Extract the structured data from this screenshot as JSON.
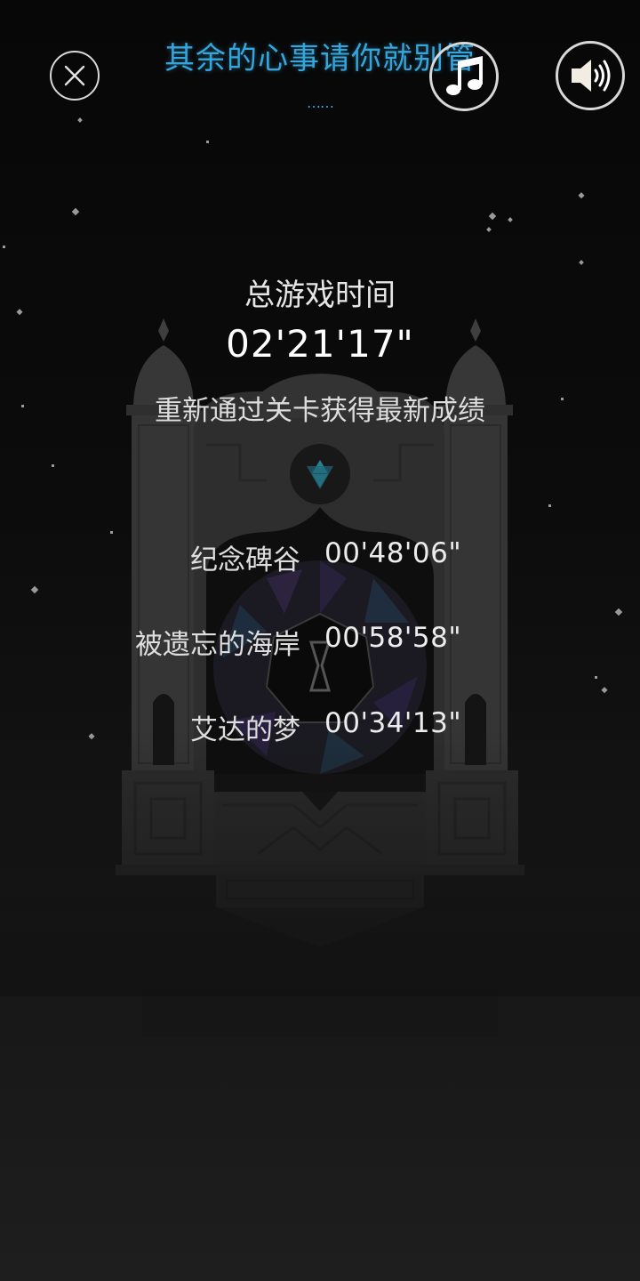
{
  "header": {
    "song_title": "其余的心事请你就别管",
    "song_dots": "……",
    "close_icon": "close-icon",
    "music_icon": "music-note-icon",
    "sound_icon": "speaker-volume-icon"
  },
  "summary": {
    "total_label": "总游戏时间",
    "total_time": "02'21'17\"",
    "hint": "重新通过关卡获得最新成绩"
  },
  "levels": [
    {
      "name": "纪念碑谷",
      "time": "00'48'06\""
    },
    {
      "name": "被遗忘的海岸",
      "time": "00'58'58\""
    },
    {
      "name": "艾达的梦",
      "time": "00'34'13\""
    }
  ],
  "colors": {
    "accent": "#35a6dc",
    "background": "#0a0a0a",
    "text": "#e6e6e6",
    "icon": "#d8d8d8"
  }
}
